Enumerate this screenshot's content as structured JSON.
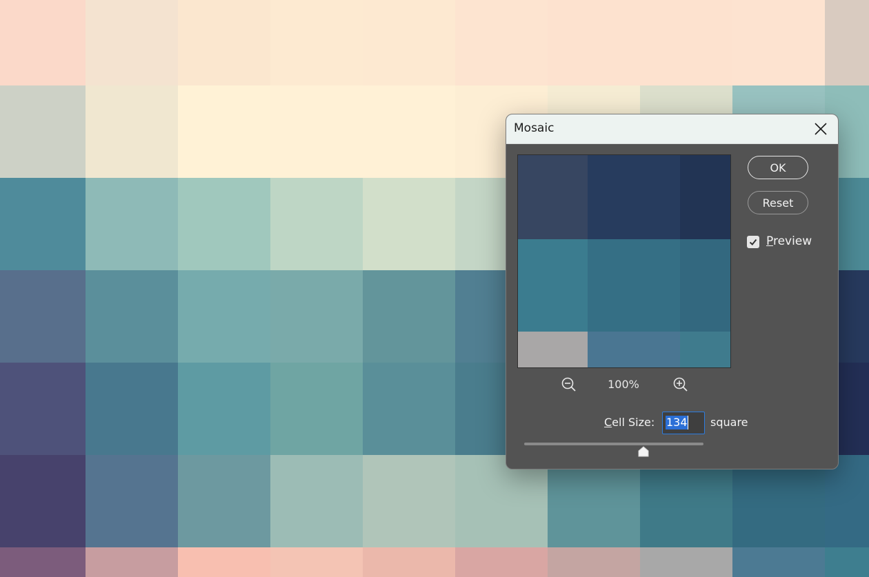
{
  "canvas": {
    "cell_columns": [
      0,
      124,
      258,
      392,
      526,
      660,
      794,
      928,
      1062,
      1196,
      1260
    ],
    "cell_rows": [
      0,
      124,
      258,
      392,
      526,
      660,
      794,
      837
    ],
    "cell_colors": [
      [
        "#fbd9c9",
        "#f4e3d0",
        "#fbe7cf",
        "#fdead1",
        "#fde9d1",
        "#fde4d0",
        "#fde2cf",
        "#fde2cf",
        "#fde3d0",
        "#d9cbc0"
      ],
      [
        "#cdd1c6",
        "#f0e7d0",
        "#fff2d6",
        "#fff1d6",
        "#fff1d6",
        "#fdeed4",
        "#f5ecd3",
        "#dcdfcc",
        "#98c2c0",
        "#8ebdb9"
      ],
      [
        "#4f8b9b",
        "#8ebab7",
        "#a0c8bd",
        "#bed6c5",
        "#d2dfca",
        "#c4d6c6",
        "#8cb8b6",
        "#6aa6ad",
        "#57969f",
        "#4d8b97"
      ],
      [
        "#586f8c",
        "#5b8f9b",
        "#76abad",
        "#7aaaaa",
        "#63959b",
        "#517f92",
        "#3f6f89",
        "#355f83",
        "#2b4d74",
        "#273a5e"
      ],
      [
        "#4e527a",
        "#48788e",
        "#5e9ba3",
        "#6fa5a3",
        "#5a8f99",
        "#4a7d8d",
        "#3c6880",
        "#2f5678",
        "#26426b",
        "#232f56"
      ],
      [
        "#47426c",
        "#557490",
        "#6d99a0",
        "#9cbcb5",
        "#b0c5b9",
        "#a6c1b6",
        "#5f949a",
        "#3f7a88",
        "#346b81",
        "#346a84"
      ],
      [
        "#7c5c7c",
        "#c79da0",
        "#f8bfb0",
        "#f4c4b4",
        "#ebb8ab",
        "#d9a6a3",
        "#c4a5a2",
        "#a8a8a8",
        "#4c7a93",
        "#3e7e8f"
      ]
    ]
  },
  "dialog": {
    "title": "Mosaic",
    "ok_label": "OK",
    "reset_label": "Reset",
    "preview_label": "Preview",
    "preview_checked": true,
    "zoom_level": "100%",
    "cell_size_label": "Cell Size:",
    "cell_size_value": "134",
    "unit_label": "square",
    "slider_fraction": 0.667,
    "preview_thumb": {
      "cell_columns": [
        0,
        101,
        235,
        308
      ],
      "cell_rows": [
        0,
        122,
        256,
        308
      ],
      "cell_colors": [
        [
          "#374661",
          "#273c5e",
          "#223454"
        ],
        [
          "#3b7c8f",
          "#356f85",
          "#33687f"
        ],
        [
          "#a9a7a7",
          "#4a7692",
          "#3f7b8d"
        ]
      ]
    }
  }
}
